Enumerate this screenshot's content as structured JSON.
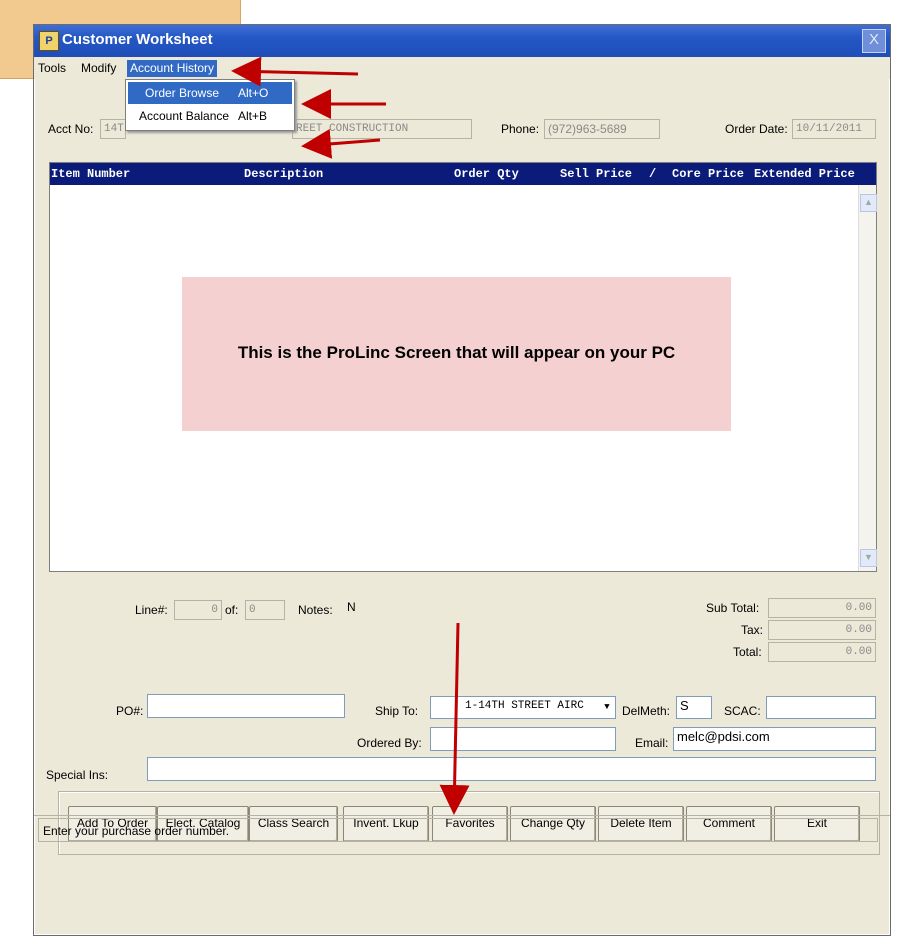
{
  "window": {
    "title": "Customer Worksheet",
    "close_glyph": "X"
  },
  "menu": {
    "tools": "Tools",
    "modify": "Modify",
    "account_history": "Account History"
  },
  "dropdown": {
    "items": [
      {
        "label": "Order Browse",
        "shortcut": "Alt+O"
      },
      {
        "label": "Account Balance",
        "shortcut": "Alt+B"
      }
    ]
  },
  "header": {
    "acct_label": "Acct No:",
    "acct_value": "14T",
    "customer_name": "REET CONSTRUCTION",
    "phone_label": "Phone:",
    "phone_value": "(972)963-5689",
    "order_date_label": "Order Date:",
    "order_date_value": "10/11/2011"
  },
  "grid": {
    "columns": [
      "Item Number",
      "Description",
      "Order Qty",
      "Sell Price",
      "/",
      "Core Price",
      "Extended Price"
    ]
  },
  "banner": "This is the ProLinc Screen that will appear on your PC",
  "footer": {
    "line_label": "Line#:",
    "line_value": "0",
    "of_label": "of:",
    "of_value": "0",
    "notes_label": "Notes:",
    "notes_value": "N",
    "subtotal_label": "Sub Total:",
    "subtotal_value": "0.00",
    "tax_label": "Tax:",
    "tax_value": "0.00",
    "total_label": "Total:",
    "total_value": "0.00",
    "po_label": "PO#:",
    "po_value": "",
    "shipto_label": "Ship To:",
    "shipto_value": "1-14TH STREET AIRC",
    "delmeth_label": "DelMeth:",
    "delmeth_value": "S",
    "scac_label": "SCAC:",
    "scac_value": "",
    "orderedby_label": "Ordered By:",
    "orderedby_value": "",
    "email_label": "Email:",
    "email_value": "melc@pdsi.com",
    "special_label": "Special Ins:",
    "special_value": ""
  },
  "buttons": [
    "Add To Order",
    "Elect. Catalog",
    "Class Search",
    "Invent. Lkup",
    "Favorites",
    "Change Qty",
    "Delete Item",
    "Comment",
    "Exit"
  ],
  "status": "Enter your purchase order number.",
  "colors": {
    "titlebar": "#2457c5",
    "grid_header": "#0a1b7a",
    "banner": "#f5d0d0",
    "arrow": "#c00000",
    "highlight": "#316ac5"
  }
}
